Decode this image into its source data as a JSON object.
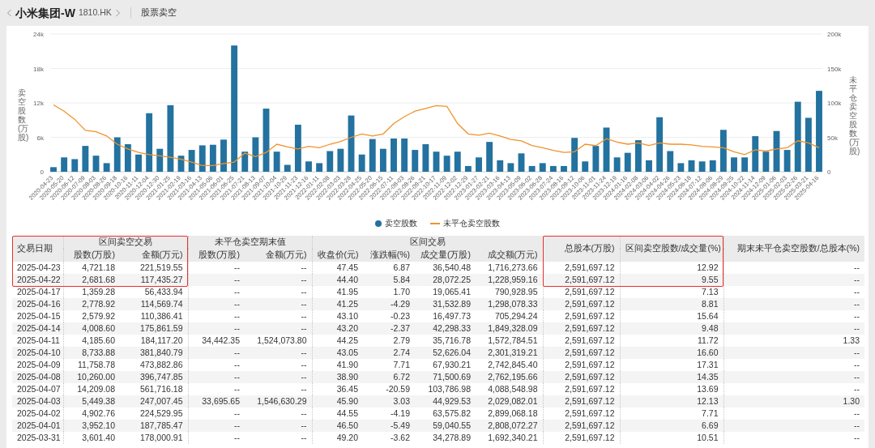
{
  "header": {
    "company": "小米集团-W",
    "code": "1810.HK",
    "section": "股票卖空"
  },
  "chart": {
    "bars": {
      "chart_data": {
        "type": "bar",
        "ylabel": "卖空股数(万股)",
        "grid": true,
        "categories": [
          "2020-04-23",
          "2020-05-20",
          "2020-06-12",
          "2020-07-09",
          "2020-08-03",
          "2020-08-26",
          "2020-09-18",
          "2020-10-16",
          "2020-11-11",
          "2020-12-04",
          "2020-12-30",
          "2021-01-25",
          "2021-02-19",
          "2021-03-16",
          "2021-04-13",
          "2021-05-06",
          "2021-06-01",
          "2021-06-25",
          "2021-07-21",
          "2021-08-13",
          "2021-09-07",
          "2021-10-04",
          "2021-10-29",
          "2021-11-23",
          "2021-12-16",
          "2022-01-11",
          "2022-02-08",
          "2022-03-03",
          "2022-03-28",
          "2022-04-25",
          "2022-05-20",
          "2022-06-15",
          "2022-07-11",
          "2022-08-03",
          "2022-08-26",
          "2022-09-21",
          "2022-10-17",
          "2022-11-09",
          "2022-12-02",
          "2022-12-29",
          "2023-01-27",
          "2023-02-21",
          "2023-03-16",
          "2023-04-13",
          "2023-05-09",
          "2023-06-02",
          "2023-06-28",
          "2023-07-24",
          "2023-08-16",
          "2023-09-12",
          "2023-10-06",
          "2023-11-01",
          "2023-11-24",
          "2023-12-19",
          "2024-01-16",
          "2024-02-08",
          "2024-03-06",
          "2024-04-02",
          "2024-04-26",
          "2024-05-23",
          "2024-06-18",
          "2024-07-12",
          "2024-08-06",
          "2024-08-29",
          "2024-09-25",
          "2024-10-22",
          "2024-11-14",
          "2024-12-09",
          "2025-01-06",
          "2025-02-03",
          "2025-02-26",
          "2025-03-21",
          "2025-04-16"
        ],
        "ylim": [
          0,
          24000
        ],
        "yticks": [
          {
            "value": 24000,
            "label": "24k"
          },
          {
            "value": 18000,
            "label": "18k"
          },
          {
            "value": 12000,
            "label": "12k"
          },
          {
            "value": 6000,
            "label": "6k"
          },
          {
            "value": 0,
            "label": "0"
          }
        ],
        "series": [
          {
            "name": "卖空股数",
            "color": "#23729f",
            "values": [
              800,
              2500,
              2200,
              4500,
              2800,
              1500,
              6000,
              4800,
              3000,
              10200,
              4000,
              11600,
              2800,
              3800,
              4600,
              4700,
              5600,
              22000,
              3500,
              6000,
              11000,
              3500,
              1200,
              8200,
              1800,
              1500,
              3600,
              4000,
              9800,
              3000,
              5700,
              4000,
              5800,
              5800,
              3800,
              4800,
              3500,
              2800,
              3500,
              1000,
              2500,
              5200,
              2000,
              1500,
              3200,
              1000,
              1500,
              1000,
              1000,
              5900,
              1800,
              4500,
              7700,
              2500,
              3300,
              5500,
              2000,
              9500,
              3600,
              1500,
              2000,
              1800,
              2000,
              7300,
              2500,
              2500,
              6200,
              3500,
              7100,
              3800,
              12200,
              9400,
              14100
            ]
          }
        ]
      }
    },
    "line": {
      "chart_data": {
        "type": "line",
        "ylabel": "未平仓卖空股数(万股)",
        "ylim": [
          0,
          200000
        ],
        "yticks": [
          {
            "value": 200000,
            "label": "200k"
          },
          {
            "value": 150000,
            "label": "150k"
          },
          {
            "value": 100000,
            "label": "100k"
          },
          {
            "value": 50000,
            "label": "50k"
          },
          {
            "value": 0,
            "label": "0"
          }
        ],
        "series": [
          {
            "name": "未平仓卖空股数",
            "color": "#f0932b",
            "values": [
              97000,
              88000,
              76000,
              60000,
              58000,
              52000,
              40000,
              33000,
              28000,
              25000,
              23000,
              21000,
              18000,
              14000,
              9000,
              9000,
              12000,
              14000,
              27000,
              22000,
              28000,
              40000,
              36000,
              33000,
              37000,
              35000,
              40000,
              44000,
              50000,
              55000,
              52000,
              55000,
              70000,
              80000,
              88000,
              92000,
              96000,
              95000,
              70000,
              55000,
              53000,
              56000,
              52000,
              47000,
              45000,
              38000,
              35000,
              31000,
              28000,
              29000,
              40000,
              38000,
              48000,
              43000,
              40000,
              42000,
              38000,
              42000,
              40000,
              40000,
              39000,
              37000,
              36000,
              35000,
              29000,
              25000,
              32000,
              30000,
              33000,
              35000,
              45000,
              42000,
              35000
            ]
          }
        ]
      }
    }
  },
  "table": {
    "groups": [
      {
        "label": "交易日期",
        "highlighted": true
      },
      {
        "label": "区间卖空交易",
        "highlighted": true,
        "columns": [
          "股数(万股)",
          "金额(万元)"
        ]
      },
      {
        "label": "未平仓卖空期末值",
        "highlighted": false,
        "columns": [
          "股数(万股)",
          "金额(万元)"
        ]
      },
      {
        "label": "区间交易",
        "highlighted": false,
        "columns": [
          "收盘价(元)",
          "涨跌幅(%)",
          "成交量(万股)",
          "成交额(万元)"
        ]
      },
      {
        "label": "总股本(万股)",
        "highlighted": true
      },
      {
        "label": "区间卖空股数/成交量(%)",
        "highlighted": true
      },
      {
        "label": "期末未平仓卖空股数/总股本(%)",
        "highlighted": false
      }
    ],
    "rows": [
      {
        "highlighted": true,
        "cells": [
          "2025-04-23",
          "4,721.18",
          "221,519.55",
          "--",
          "--",
          "47.45",
          "6.87",
          "36,540.48",
          "1,716,273.66",
          "2,591,697.12",
          "12.92",
          "--"
        ]
      },
      {
        "highlighted": true,
        "cells": [
          "2025-04-22",
          "2,681.68",
          "117,435.27",
          "--",
          "--",
          "44.40",
          "5.84",
          "28,072.25",
          "1,228,959.16",
          "2,591,697.12",
          "9.55",
          "--"
        ]
      },
      {
        "highlighted": false,
        "cells": [
          "2025-04-17",
          "1,359.28",
          "56,433.94",
          "--",
          "--",
          "41.95",
          "1.70",
          "19,065.41",
          "790,928.95",
          "2,591,697.12",
          "7.13",
          "--"
        ]
      },
      {
        "highlighted": false,
        "cells": [
          "2025-04-16",
          "2,778.92",
          "114,569.74",
          "--",
          "--",
          "41.25",
          "-4.29",
          "31,532.89",
          "1,298,078.33",
          "2,591,697.12",
          "8.81",
          "--"
        ]
      },
      {
        "highlighted": false,
        "cells": [
          "2025-04-15",
          "2,579.92",
          "110,386.41",
          "--",
          "--",
          "43.10",
          "-0.23",
          "16,497.73",
          "705,294.24",
          "2,591,697.12",
          "15.64",
          "--"
        ]
      },
      {
        "highlighted": false,
        "cells": [
          "2025-04-14",
          "4,008.60",
          "175,861.59",
          "--",
          "--",
          "43.20",
          "-2.37",
          "42,298.33",
          "1,849,328.09",
          "2,591,697.12",
          "9.48",
          "--"
        ]
      },
      {
        "highlighted": false,
        "cells": [
          "2025-04-11",
          "4,185.60",
          "184,117.20",
          "34,442.35",
          "1,524,073.80",
          "44.25",
          "2.79",
          "35,716.78",
          "1,572,784.51",
          "2,591,697.12",
          "11.72",
          "1.33"
        ]
      },
      {
        "highlighted": false,
        "cells": [
          "2025-04-10",
          "8,733.88",
          "381,840.79",
          "--",
          "--",
          "43.05",
          "2.74",
          "52,626.04",
          "2,301,319.21",
          "2,591,697.12",
          "16.60",
          "--"
        ]
      },
      {
        "highlighted": false,
        "cells": [
          "2025-04-09",
          "11,758.78",
          "473,882.86",
          "--",
          "--",
          "41.90",
          "7.71",
          "67,930.21",
          "2,742,845.40",
          "2,591,697.12",
          "17.31",
          "--"
        ]
      },
      {
        "highlighted": false,
        "cells": [
          "2025-04-08",
          "10,260.00",
          "396,747.85",
          "--",
          "--",
          "38.90",
          "6.72",
          "71,500.69",
          "2,762,195.66",
          "2,591,697.12",
          "14.35",
          "--"
        ]
      },
      {
        "highlighted": false,
        "cells": [
          "2025-04-07",
          "14,209.08",
          "561,716.18",
          "--",
          "--",
          "36.45",
          "-20.59",
          "103,786.98",
          "4,088,548.98",
          "2,591,697.12",
          "13.69",
          "--"
        ]
      },
      {
        "highlighted": false,
        "cells": [
          "2025-04-03",
          "5,449.38",
          "247,007.45",
          "33,695.65",
          "1,546,630.29",
          "45.90",
          "3.03",
          "44,929.53",
          "2,029,082.01",
          "2,591,697.12",
          "12.13",
          "1.30"
        ]
      },
      {
        "highlighted": false,
        "cells": [
          "2025-04-02",
          "4,902.76",
          "224,529.95",
          "--",
          "--",
          "44.55",
          "-4.19",
          "63,575.82",
          "2,899,068.18",
          "2,591,697.12",
          "7.71",
          "--"
        ]
      },
      {
        "highlighted": false,
        "cells": [
          "2025-04-01",
          "3,952.10",
          "187,785.47",
          "--",
          "--",
          "46.50",
          "-5.49",
          "59,040.55",
          "2,808,072.27",
          "2,591,697.12",
          "6.69",
          "--"
        ]
      },
      {
        "highlighted": false,
        "cells": [
          "2025-03-31",
          "3,601.40",
          "178,000.91",
          "--",
          "--",
          "49.20",
          "-3.62",
          "34,278.89",
          "1,692,340.21",
          "2,591,697.12",
          "10.51",
          "--"
        ]
      }
    ]
  }
}
